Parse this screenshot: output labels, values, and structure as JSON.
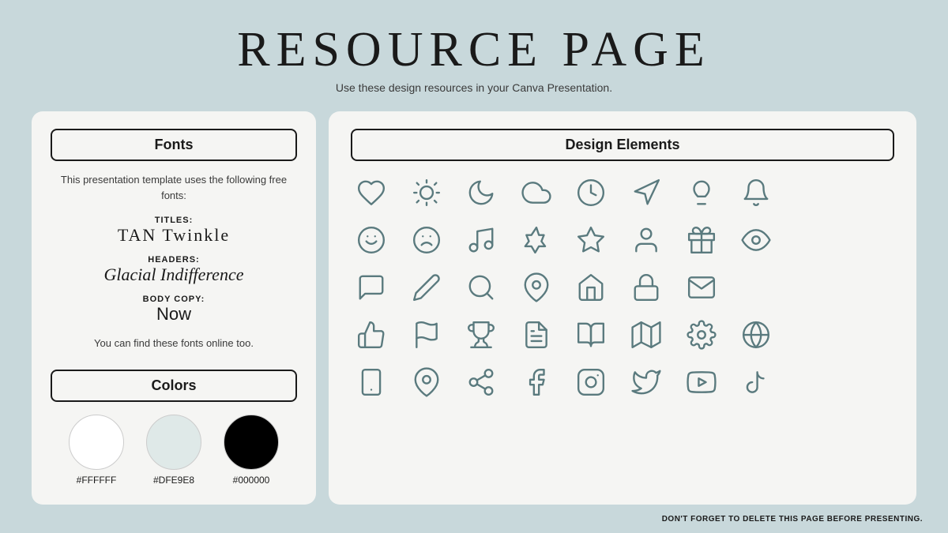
{
  "header": {
    "title": "RESOURCE PAGE",
    "subtitle": "Use these design resources in your Canva Presentation."
  },
  "left_panel": {
    "fonts_section": {
      "label": "Fonts",
      "description": "This presentation template uses the following free fonts:",
      "entries": [
        {
          "label": "TITLES:",
          "name": "TAN Twinkle"
        },
        {
          "label": "HEADERS:",
          "name": "Glacial Indifference"
        },
        {
          "label": "BODY COPY:",
          "name": "Now"
        }
      ],
      "note": "You can find these fonts online too."
    },
    "colors_section": {
      "label": "Colors",
      "swatches": [
        {
          "hex": "#FFFFFF",
          "label": "#FFFFFF"
        },
        {
          "hex": "#DFE9E8",
          "label": "#DFE9E8"
        },
        {
          "hex": "#000000",
          "label": "#000000"
        }
      ]
    }
  },
  "right_panel": {
    "label": "Design Elements"
  },
  "footer": {
    "note": "DON'T FORGET TO DELETE THIS PAGE BEFORE PRESENTING."
  }
}
